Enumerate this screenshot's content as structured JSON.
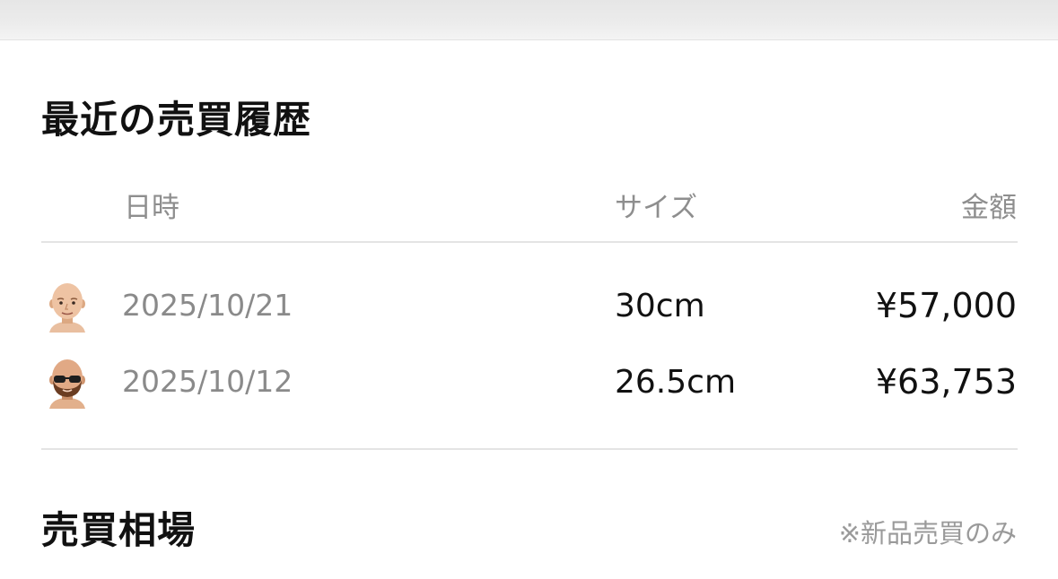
{
  "history": {
    "title": "最近の売買履歴",
    "headers": {
      "date": "日時",
      "size": "サイズ",
      "price": "金額"
    },
    "rows": [
      {
        "avatar": "bald-man-avatar-icon",
        "date": "2025/10/21",
        "size": "30cm",
        "price": "¥57,000"
      },
      {
        "avatar": "bearded-sunglasses-man-avatar-icon",
        "date": "2025/10/12",
        "size": "26.5cm",
        "price": "¥63,753"
      }
    ]
  },
  "market": {
    "title": "売買相場",
    "note": "※新品売買のみ"
  },
  "colors": {
    "text_primary": "#111111",
    "text_secondary": "#8a8a8a",
    "divider": "#e4e4e4",
    "skin": "#e7b896"
  }
}
